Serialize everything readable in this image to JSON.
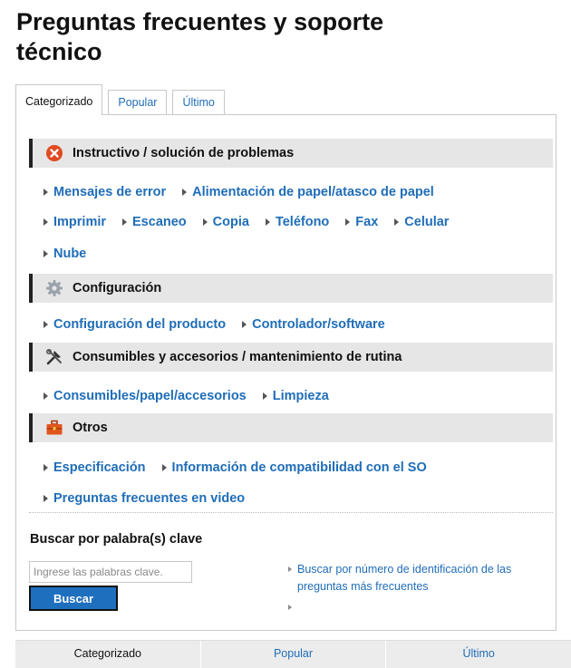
{
  "page": {
    "title": "Preguntas frecuentes y soporte técnico"
  },
  "tabs": [
    {
      "label": "Categorizado",
      "active": true
    },
    {
      "label": "Popular",
      "active": false
    },
    {
      "label": "Último",
      "active": false
    }
  ],
  "sections": [
    {
      "title": "Instructivo / solución de problemas",
      "icon": "error-circle-icon",
      "rows": [
        [
          "Mensajes de error",
          "Alimentación de papel/atasco de papel"
        ],
        [
          "Imprimir",
          "Escaneo",
          "Copia",
          "Teléfono",
          "Fax",
          "Celular"
        ],
        [
          "Nube"
        ]
      ]
    },
    {
      "title": "Configuración",
      "icon": "gear-icon",
      "rows": [
        [
          "Configuración del producto",
          "Controlador/software"
        ]
      ]
    },
    {
      "title": "Consumibles y accesorios / mantenimiento de rutina",
      "icon": "tools-icon",
      "rows": [
        [
          "Consumibles/papel/accesorios",
          "Limpieza"
        ]
      ]
    },
    {
      "title": "Otros",
      "icon": "toolbox-icon",
      "rows": [
        [
          "Especificación",
          "Información de compatibilidad con el SO"
        ],
        [
          "Preguntas frecuentes en video"
        ]
      ]
    }
  ],
  "search": {
    "heading": "Buscar por palabra(s) clave",
    "placeholder": "Ingrese las palabras clave.",
    "button": "Buscar",
    "side_link": "Buscar por número de identificación de las preguntas más frecuentes"
  },
  "bottom_tabs": [
    {
      "label": "Categorizado",
      "active": true
    },
    {
      "label": "Popular",
      "active": false
    },
    {
      "label": "Último",
      "active": false
    }
  ],
  "colors": {
    "link": "#1f6db8",
    "button": "#1f6fbf",
    "header_bg": "#e6e6e6",
    "error_icon": "#e04a1f",
    "toolbox_icon": "#e0561c"
  }
}
